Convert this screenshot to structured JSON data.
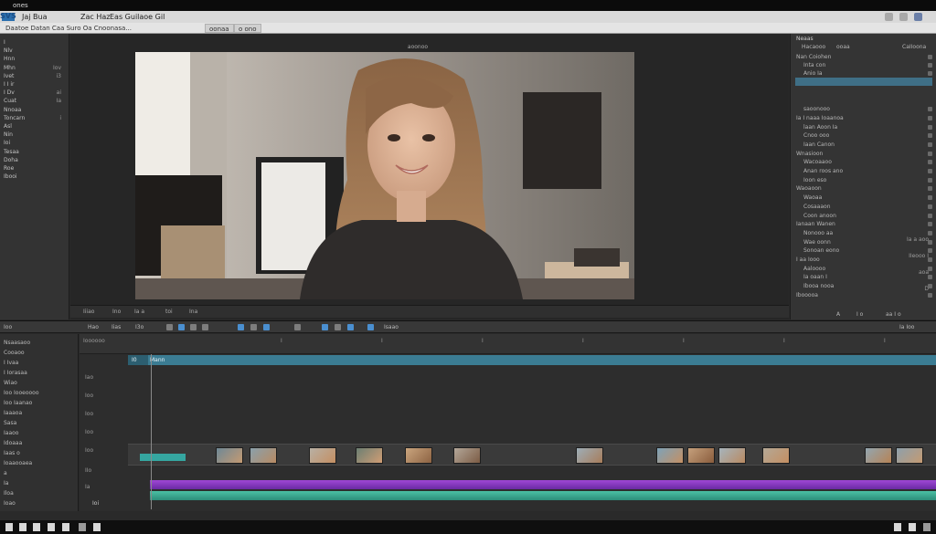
{
  "window": {
    "title": "ones"
  },
  "menu": {
    "items": [
      "SVS",
      "Jaj Bua",
      "Zac Haz",
      "Eas Guilaoe Gil"
    ],
    "second_row": "Daatoe Datan Caa Suro Oa Cnoonasa..."
  },
  "toolbar": {
    "buttons": [
      "oonaa",
      "o ono"
    ]
  },
  "left_panel": {
    "items": [
      {
        "label": "I",
        "value": ""
      },
      {
        "label": "Nlv",
        "value": ""
      },
      {
        "label": "Hnn",
        "value": ""
      },
      {
        "label": "Mhn",
        "value": "Iov"
      },
      {
        "label": "Ivet",
        "value": "i3"
      },
      {
        "label": "I I ir",
        "value": ""
      },
      {
        "label": "I Dv",
        "value": "ai"
      },
      {
        "label": "Cuat",
        "value": "Ia"
      },
      {
        "label": "Nnoaa",
        "value": ""
      },
      {
        "label": "Toncarn",
        "value": "i"
      },
      {
        "label": "Asl",
        "value": ""
      },
      {
        "label": "Nin",
        "value": ""
      },
      {
        "label": "Ioi",
        "value": ""
      },
      {
        "label": "Tesaa",
        "value": ""
      },
      {
        "label": "Doha",
        "value": ""
      },
      {
        "label": "Roe",
        "value": ""
      },
      {
        "label": "Ibooi",
        "value": ""
      }
    ]
  },
  "preview": {
    "title": "aoonoo",
    "bar_items": [
      "Iiiao",
      "Ino",
      "Ia a",
      "toi",
      "Ina"
    ]
  },
  "inspector": {
    "header": "Neaas",
    "header_values": [
      "Hacaooo",
      "ooaa",
      "CaIIoona"
    ],
    "rows": [
      "Nan Coiohen",
      "Inta con",
      "Anio Ia",
      "saoonooo",
      "Ia I naaa Ioaanoa",
      "laan Aoon Ia",
      "Cnoo ooo",
      "Iaan Canon",
      "Wnasioon",
      "Wacoaaoo",
      "Anan roos ano",
      "Ioon eso",
      "Waoaoon",
      "Waoaa",
      "Cosaaaon",
      "Coon anoon",
      "Ianaan Wanen",
      "Nonooo aa",
      "Wae oonn",
      "Sonoan eono",
      "I aa Iooo",
      "Aaloooo",
      "Ia oaan I",
      "Ibooa nooa",
      "Ibooooa"
    ],
    "row_values": [
      "Ia a aoo",
      "IIeooo I",
      "aoa",
      "D"
    ],
    "footer": [
      "A",
      "I o",
      "aa I o"
    ]
  },
  "timeline_toolbar": {
    "left_label": "Ioo",
    "items": [
      "Hao",
      "Iias",
      "I3o",
      "Isaao"
    ],
    "right_label": "Ia Ioo"
  },
  "timeline_left": {
    "items": [
      "Nsaasaoo",
      "Cooaoo",
      "I Ivaa",
      "I Iorasaa",
      "Wiao",
      "Ioo Iooeoooo",
      "Ioo Iaanao",
      "Iaaaoa",
      "Sasa",
      "Iaaoo",
      "Idoaaa",
      "Iaas o",
      "Ioaaooaea",
      "a",
      "Ia",
      "Iloa",
      "Ioao"
    ]
  },
  "timeline": {
    "ruler_label": "Ioooooo",
    "ruler_marks": [
      "Ioooooo",
      "I",
      "I",
      "I",
      "I",
      "I",
      "I",
      "I"
    ],
    "blue_clip_label": "Mann",
    "blue_prefix": "I0",
    "track_labels": [
      "Iao",
      "Ioo",
      "Ioo",
      "Ioo",
      "Ioo",
      "IIo",
      "Ia"
    ],
    "timecode": "Ioi"
  },
  "colors": {
    "accent_blue": "#3b7c93",
    "audio_purple": "#9f47d6",
    "audio_green": "#4ac1a4",
    "clip_teal": "#35a6a0"
  },
  "icons": [
    "play-icon",
    "cut-icon",
    "gear-icon",
    "speaker-icon",
    "taskbar-app-icon"
  ]
}
